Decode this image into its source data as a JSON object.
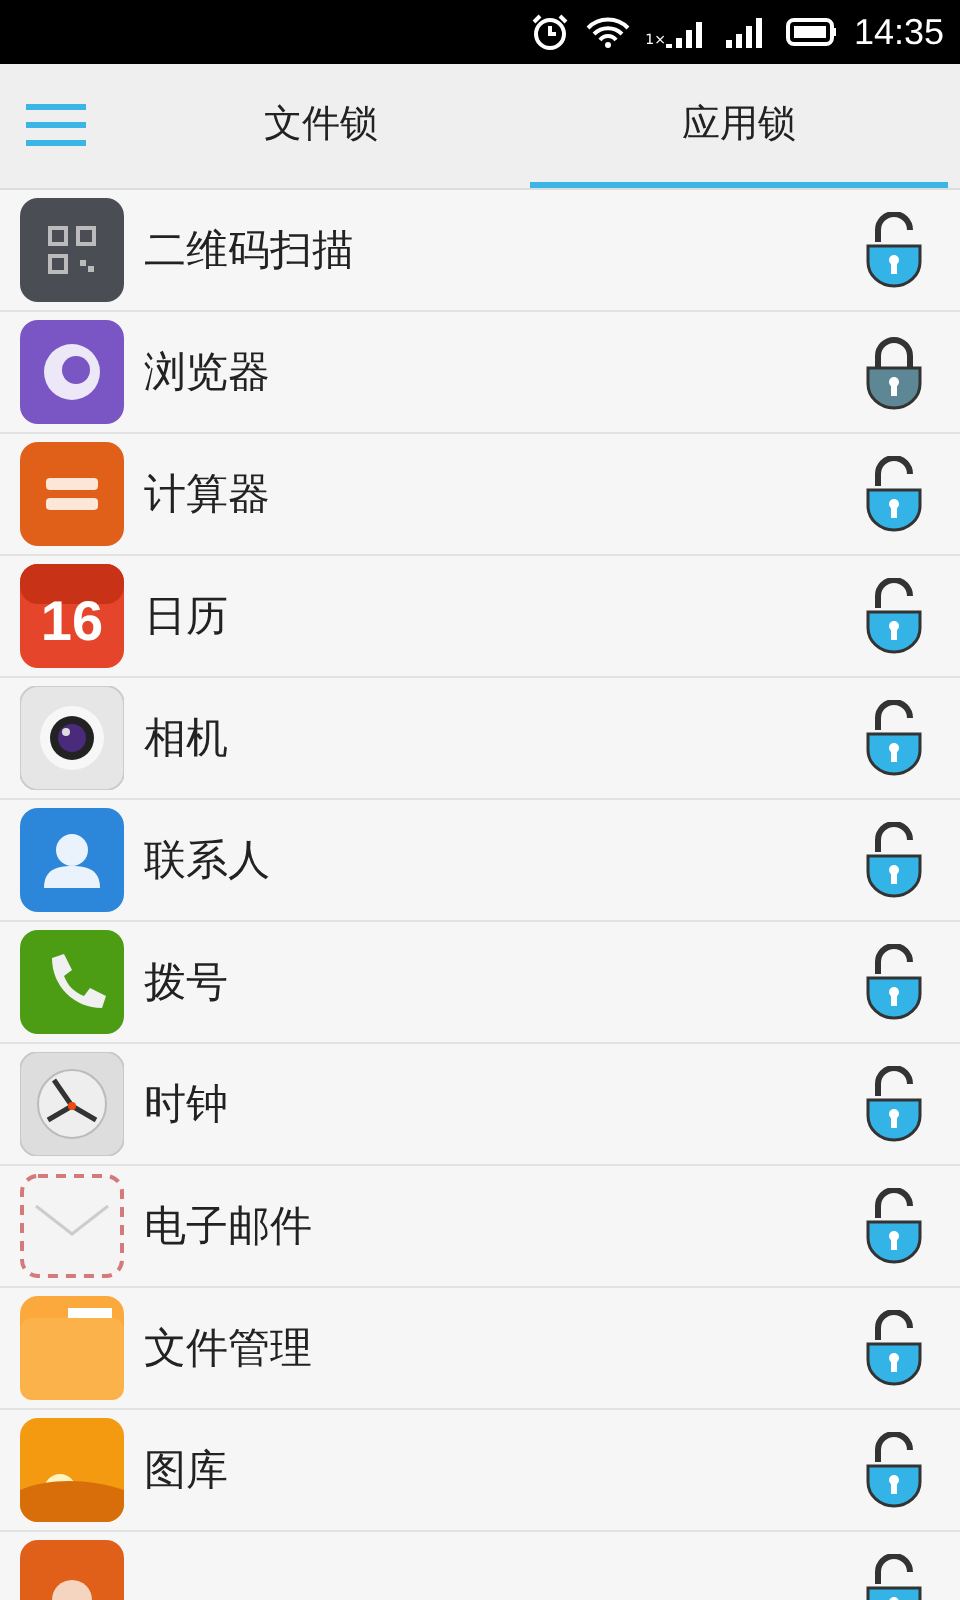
{
  "status_bar": {
    "sim_label": "1×",
    "time": "14:35"
  },
  "tabs": [
    {
      "label": "文件锁",
      "selected": false
    },
    {
      "label": "应用锁",
      "selected": true
    }
  ],
  "apps": [
    {
      "name": "二维码扫描",
      "locked": false
    },
    {
      "name": "浏览器",
      "locked": true
    },
    {
      "name": "计算器",
      "locked": false
    },
    {
      "name": "日历",
      "locked": false,
      "icon_text": "16"
    },
    {
      "name": "相机",
      "locked": false
    },
    {
      "name": "联系人",
      "locked": false
    },
    {
      "name": "拨号",
      "locked": false
    },
    {
      "name": "时钟",
      "locked": false
    },
    {
      "name": "电子邮件",
      "locked": false
    },
    {
      "name": "文件管理",
      "locked": false
    },
    {
      "name": "图库",
      "locked": false
    },
    {
      "locked": false
    }
  ]
}
